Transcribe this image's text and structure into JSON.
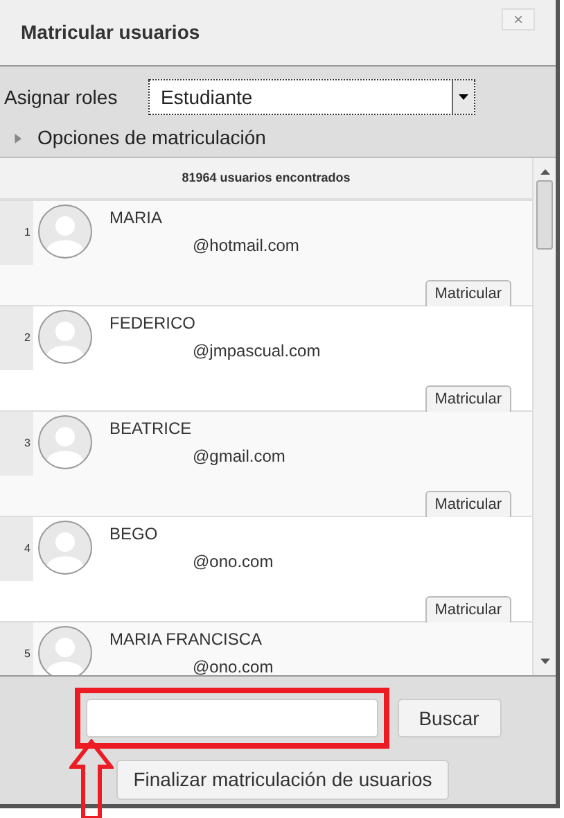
{
  "window": {
    "title": "Matricular usuarios",
    "close": "×"
  },
  "roles": {
    "label": "Asignar roles",
    "value": "Estudiante"
  },
  "options": {
    "label": "Opciones de matriculación",
    "expanded": false
  },
  "list": {
    "header": "81964 usuarios encontrados",
    "rows": [
      {
        "index": "1",
        "name": "MARIA",
        "email": "@hotmail.com",
        "button": "Matricular"
      },
      {
        "index": "2",
        "name": "FEDERICO",
        "email": "@jmpascual.com",
        "button": "Matricular"
      },
      {
        "index": "3",
        "name": "BEATRICE",
        "email": "@gmail.com",
        "button": "Matricular"
      },
      {
        "index": "4",
        "name": "BEGO",
        "email": "@ono.com",
        "button": "Matricular"
      },
      {
        "index": "5",
        "name": "MARIA FRANCISCA",
        "email": "@ono.com"
      }
    ]
  },
  "search": {
    "button": "Buscar"
  },
  "finish_button": "Finalizar matriculación de usuarios"
}
